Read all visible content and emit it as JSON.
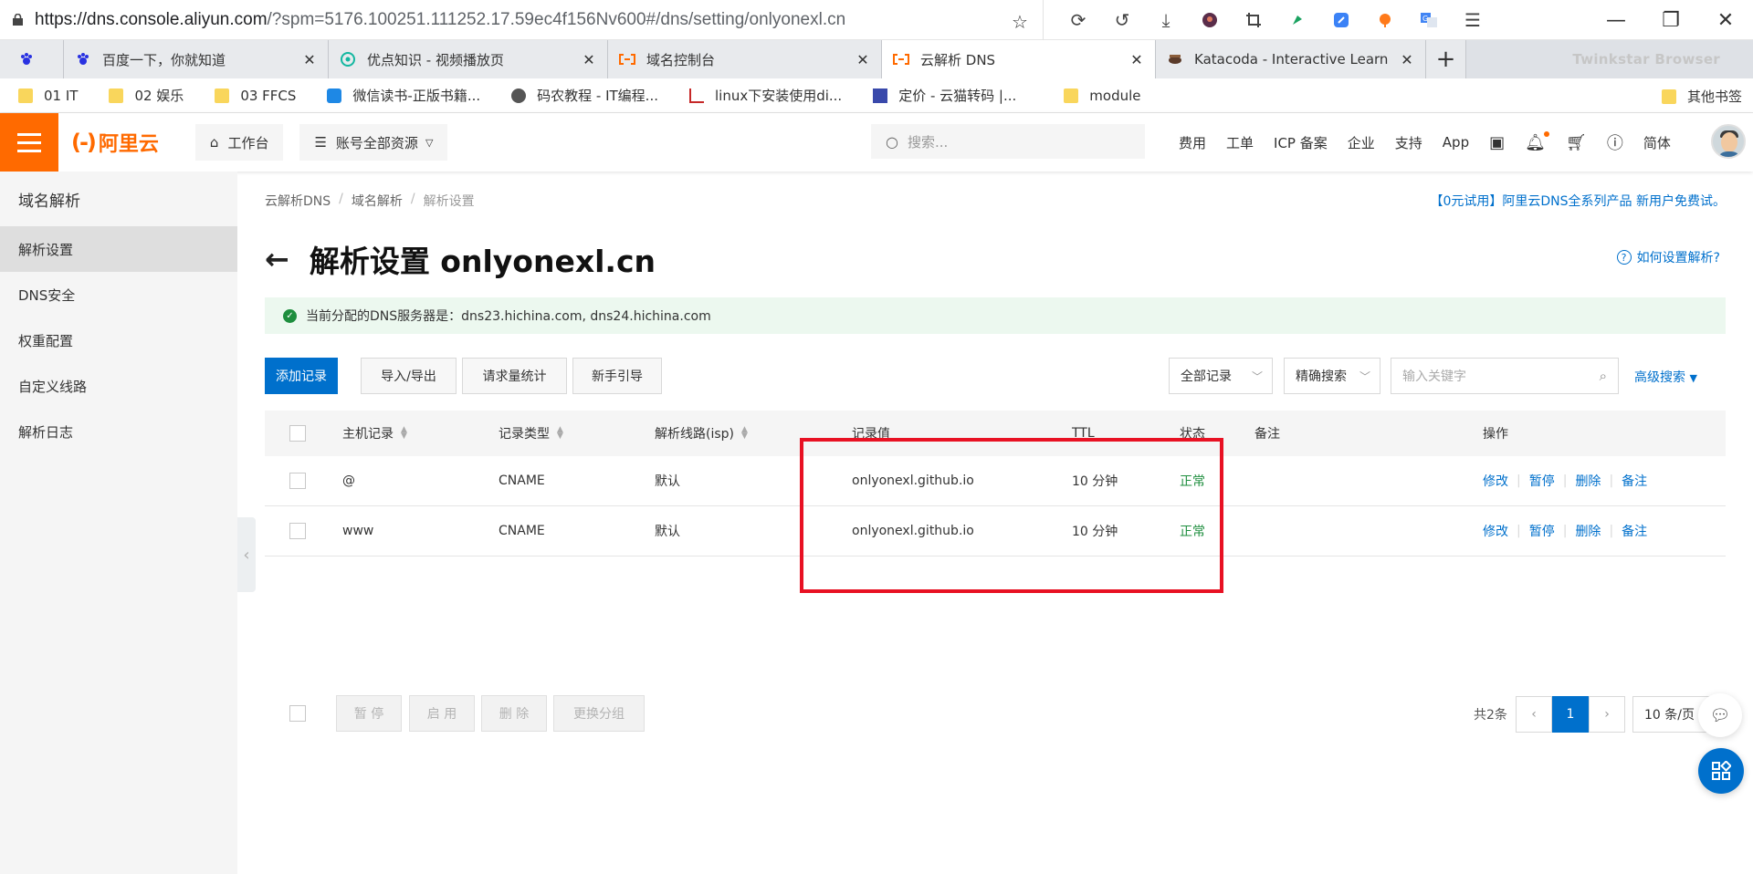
{
  "browser": {
    "url_host": "https://dns.console.aliyun.com",
    "url_rest": "/?spm=5176.100251.111252.17.59ec4f156Nv600#/dns/setting/onlyonexl.cn",
    "tabs": [
      {
        "label": "",
        "icon": "baidu-paw-icon"
      },
      {
        "label": "百度一下，你就知道",
        "icon": "baidu-paw-icon"
      },
      {
        "label": "优点知识 - 视频播放页",
        "icon": "youdian-icon"
      },
      {
        "label": "域名控制台",
        "icon": "aliyun-icon"
      },
      {
        "label": "云解析 DNS",
        "icon": "aliyun-icon"
      },
      {
        "label": "Katacoda - Interactive Learn",
        "icon": "katacoda-icon"
      }
    ],
    "new_tab": "+",
    "brand_ghost": "Twinkstar Browser",
    "bookmarks": [
      {
        "label": "01 IT",
        "icon": "folder-icon"
      },
      {
        "label": "02 娱乐",
        "icon": "folder-icon"
      },
      {
        "label": "03 FFCS",
        "icon": "folder-icon"
      },
      {
        "label": "微信读书-正版书籍...",
        "icon": "weread-icon"
      },
      {
        "label": "码农教程 - IT编程...",
        "icon": "globe-icon"
      },
      {
        "label": "linux下安装使用di...",
        "icon": "csdn-icon"
      },
      {
        "label": "定价 - 云猫转码 |...",
        "icon": "yunmao-icon"
      },
      {
        "label": "module",
        "icon": "folder-icon"
      }
    ],
    "other_bookmarks": "其他书签"
  },
  "console": {
    "logo_text": "阿里云",
    "workbench": "工作台",
    "resources": "账号全部资源",
    "search_placeholder": "搜索...",
    "nav_links": [
      "费用",
      "工单",
      "ICP 备案",
      "企业",
      "支持",
      "App"
    ],
    "lang": "简体"
  },
  "sidebar": {
    "title": "域名解析",
    "items": [
      {
        "label": "解析设置",
        "active": true
      },
      {
        "label": "DNS安全"
      },
      {
        "label": "权重配置"
      },
      {
        "label": "自定义线路"
      },
      {
        "label": "解析日志"
      }
    ]
  },
  "main": {
    "breadcrumb": [
      "云解析DNS",
      "域名解析",
      "解析设置"
    ],
    "promo": "【0元试用】阿里云DNS全系列产品 新用户免费试。",
    "title": "解析设置 onlyonexl.cn",
    "help": "如何设置解析?",
    "notice": "当前分配的DNS服务器是：dns23.hichina.com, dns24.hichina.com",
    "toolbar": {
      "add": "添加记录",
      "import": "导入/导出",
      "stats": "请求量统计",
      "guide": "新手引导",
      "filter": "全部记录",
      "mode": "精确搜索",
      "kw_placeholder": "输入关键字",
      "advanced": "高级搜索"
    },
    "columns": [
      "主机记录",
      "记录类型",
      "解析线路(isp)",
      "记录值",
      "TTL",
      "状态",
      "备注",
      "操作"
    ],
    "rows": [
      {
        "host": "@",
        "type": "CNAME",
        "line": "默认",
        "value": "onlyonexl.github.io",
        "ttl": "10 分钟",
        "status": "正常",
        "remark": ""
      },
      {
        "host": "www",
        "type": "CNAME",
        "line": "默认",
        "value": "onlyonexl.github.io",
        "ttl": "10 分钟",
        "status": "正常",
        "remark": ""
      }
    ],
    "row_actions": [
      "修改",
      "暂停",
      "删除",
      "备注"
    ],
    "bulk": [
      "暂 停",
      "启 用",
      "删 除",
      "更换分组"
    ],
    "total": "共2条",
    "page": "1",
    "page_size": "10 条/页"
  },
  "colors": {
    "brand": "#ff6a00",
    "primary": "#0070cc",
    "ok": "#1e8e3e",
    "highlight": "#e81123"
  }
}
